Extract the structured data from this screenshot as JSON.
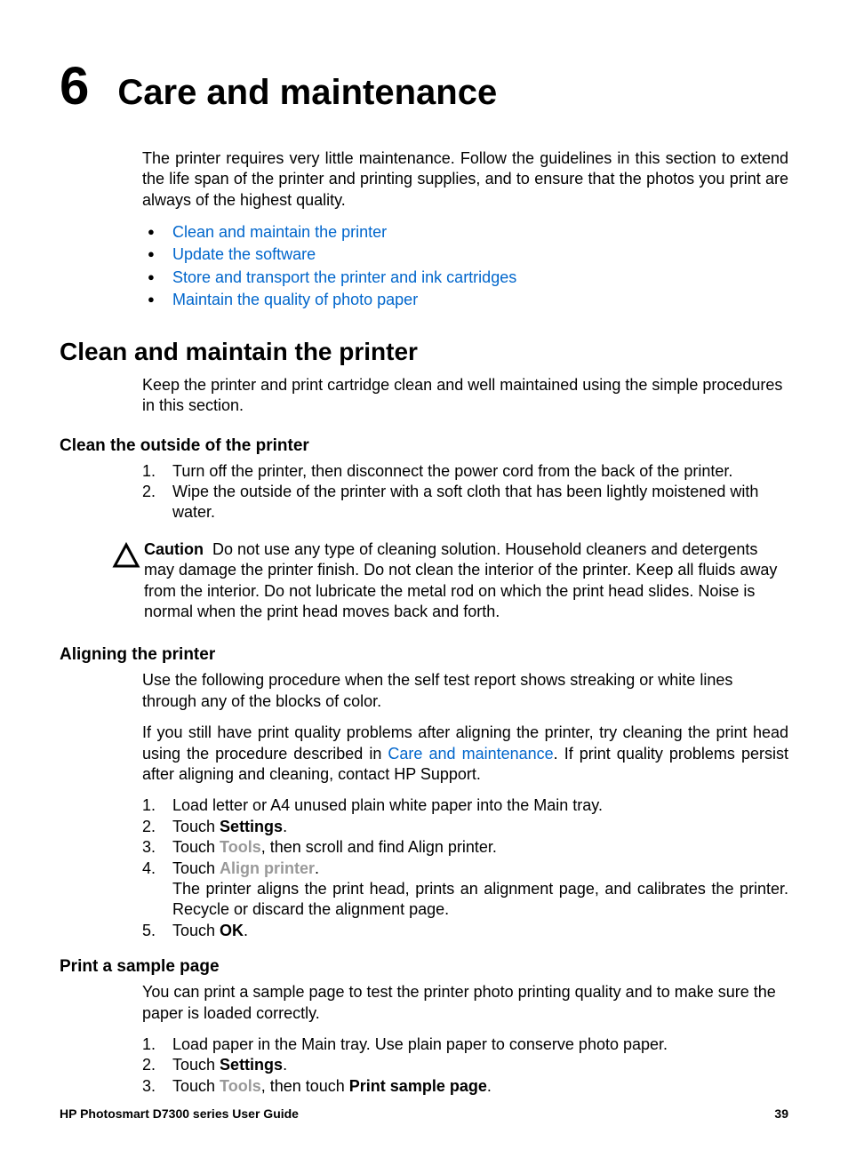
{
  "chapter": {
    "number": "6",
    "title": "Care and maintenance"
  },
  "intro": "The printer requires very little maintenance. Follow the guidelines in this section to extend the life span of the printer and printing supplies, and to ensure that the photos you print are always of the highest quality.",
  "toc_links": [
    "Clean and maintain the printer",
    "Update the software",
    "Store and transport the printer and ink cartridges",
    "Maintain the quality of photo paper"
  ],
  "section1": {
    "title": "Clean and maintain the printer",
    "text": "Keep the printer and print cartridge clean and well maintained using the simple procedures in this section."
  },
  "sub1": {
    "title": "Clean the outside of the printer",
    "step1": "Turn off the printer, then disconnect the power cord from the back of the printer.",
    "step2": "Wipe the outside of the printer with a soft cloth that has been lightly moistened with water.",
    "caution_label": "Caution",
    "caution_text": "Do not use any type of cleaning solution. Household cleaners and detergents may damage the printer finish. Do not clean the interior of the printer. Keep all fluids away from the interior. Do not lubricate the metal rod on which the print head slides. Noise is normal when the print head moves back and forth."
  },
  "sub2": {
    "title": "Aligning the printer",
    "p1": "Use the following procedure when the self test report shows streaking or white lines through any of the blocks of color.",
    "p2_a": "If you still have print quality problems after aligning the printer, try cleaning the print head using the procedure described in ",
    "p2_link": "Care and maintenance",
    "p2_b": ". If print quality problems persist after aligning and cleaning, contact HP Support.",
    "step1": "Load letter or A4 unused plain white paper into the Main tray.",
    "step2_a": "Touch ",
    "step2_b": "Settings",
    "step2_c": ".",
    "step3_a": "Touch ",
    "step3_b": "Tools",
    "step3_c": ", then scroll and find Align printer.",
    "step4_a": "Touch ",
    "step4_b": "Align printer",
    "step4_c": ".",
    "step4_sub": "The printer aligns the print head, prints an alignment page, and calibrates the printer. Recycle or discard the alignment page.",
    "step5_a": "Touch ",
    "step5_b": "OK",
    "step5_c": "."
  },
  "sub3": {
    "title": "Print a sample page",
    "p1": "You can print a sample page to test the printer photo printing quality and to make sure the paper is loaded correctly.",
    "step1": "Load paper in the Main tray. Use plain paper to conserve photo paper.",
    "step2_a": "Touch ",
    "step2_b": "Settings",
    "step2_c": ".",
    "step3_a": "Touch ",
    "step3_b": "Tools",
    "step3_c": ", then touch ",
    "step3_d": "Print sample page",
    "step3_e": "."
  },
  "footer": {
    "guide": "HP Photosmart D7300 series User Guide",
    "page": "39"
  },
  "list_nums": {
    "n1": "1.",
    "n2": "2.",
    "n3": "3.",
    "n4": "4.",
    "n5": "5."
  }
}
